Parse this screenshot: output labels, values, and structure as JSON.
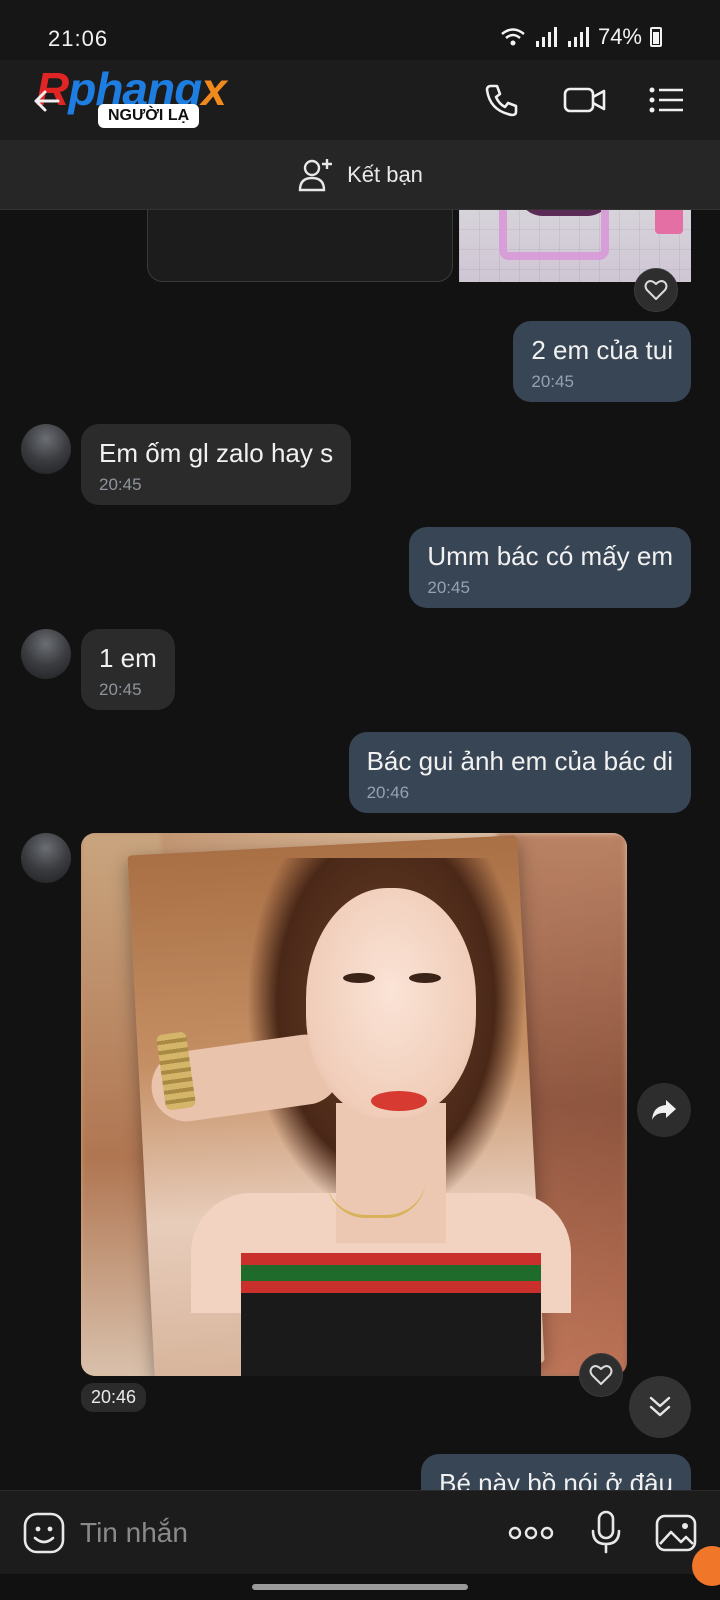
{
  "status_bar": {
    "time": "21:06",
    "battery": "74%"
  },
  "header": {
    "logo_parts": [
      "R",
      "phang",
      "x"
    ],
    "badge": "NGƯỜI LẠ",
    "colors": {
      "logo_red": "#e12424",
      "logo_blue": "#1e7de0",
      "logo_orange": "#f08a1c"
    },
    "icons": [
      "back-arrow-icon",
      "phone-icon",
      "video-call-icon",
      "menu-list-icon"
    ]
  },
  "add_friend": {
    "label": "Kết bạn"
  },
  "messages": [
    {
      "side": "out",
      "text": "2 em của tui",
      "time": "20:45"
    },
    {
      "side": "in",
      "text": "Em ốm gl zalo hay s",
      "time": "20:45"
    },
    {
      "side": "out",
      "text": "Umm bác có mấy em",
      "time": "20:45"
    },
    {
      "side": "in",
      "text": "1 em",
      "time": "20:45"
    },
    {
      "side": "out",
      "text": "Bác gui ảnh em của bác di",
      "time": "20:46"
    },
    {
      "side": "out",
      "text": "Bé này bồ nói ở đâu",
      "time": ""
    }
  ],
  "photo_message": {
    "time": "20:46"
  },
  "input": {
    "placeholder": "Tin nhắn"
  }
}
